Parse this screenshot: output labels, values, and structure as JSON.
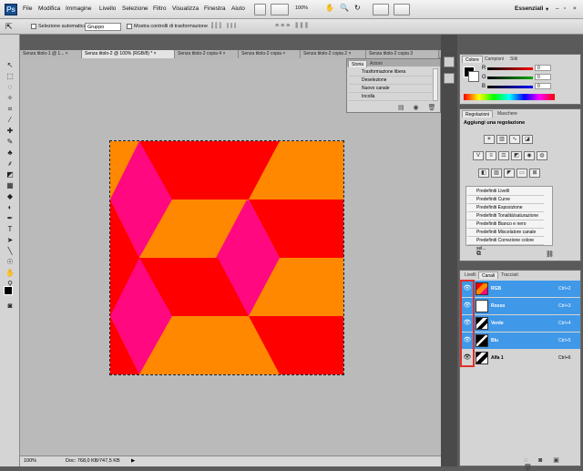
{
  "app": {
    "logo": "Ps"
  },
  "menu": [
    "File",
    "Modifica",
    "Immagine",
    "Livello",
    "Selezione",
    "Filtro",
    "Visualizza",
    "Finestra",
    "Aiuto"
  ],
  "toolbar_top": {
    "zoom": "100%",
    "workspace": "Essenziali"
  },
  "options_bar": {
    "auto_select_label": "Selezione automatica:",
    "auto_select_value": "Gruppo",
    "transform_label": "Mostra controlli di trasformazione"
  },
  "doc_tabs": [
    "Senza titolo-1 @ 1... ×",
    "Senza titolo-2 @ 100% (RGB/8) * ×",
    "Senza titolo-2 copia 4 ×",
    "Senza titolo-2 copia ×",
    "Senza titolo-2 copia 2 ×",
    "Senza titolo-2 copia 3"
  ],
  "history_panel": {
    "tabs": [
      "Storia",
      "Azioni"
    ],
    "items": [
      "Trasformazione libera",
      "Deselezione",
      "Nuovo canale",
      "Incolla"
    ]
  },
  "color_panel": {
    "tabs": [
      "Colore",
      "Campioni",
      "Stili"
    ],
    "sliders": [
      {
        "label": "R",
        "value": "0",
        "color": "#ff0000"
      },
      {
        "label": "G",
        "value": "0",
        "color": "#00aa00"
      },
      {
        "label": "B",
        "value": "0",
        "color": "#0000ff"
      }
    ]
  },
  "adjustments_panel": {
    "tabs": [
      "Regolazioni",
      "Maschere"
    ],
    "title": "Aggiungi una regolazione",
    "presets": [
      "Predefiniti Livelli",
      "Predefiniti Curve",
      "Predefiniti Esposizione",
      "Predefiniti Tonalità/saturazione",
      "Predefiniti Bianco e nero",
      "Predefiniti Miscelatore canale",
      "Predefiniti Correzione colore sel..."
    ]
  },
  "channels_panel": {
    "tabs": [
      "Livelli",
      "Canali",
      "Tracciati"
    ],
    "channels": [
      {
        "name": "RGB",
        "shortcut": "Ctrl+2",
        "selected": true
      },
      {
        "name": "Rosso",
        "shortcut": "Ctrl+3",
        "selected": true
      },
      {
        "name": "Verde",
        "shortcut": "Ctrl+4",
        "selected": true
      },
      {
        "name": "Blu",
        "shortcut": "Ctrl+5",
        "selected": true
      },
      {
        "name": "Alfa 1",
        "shortcut": "Ctrl+6",
        "selected": false
      }
    ]
  },
  "status": {
    "zoom": "100%",
    "doc_info": "Doc: 768,0 KB/747,5 KB"
  },
  "colors": {
    "red": "#ff0000",
    "orange": "#ff8800",
    "magenta": "#ff0880",
    "highlight": "#3f98e8",
    "annotation": "#e0302a"
  }
}
